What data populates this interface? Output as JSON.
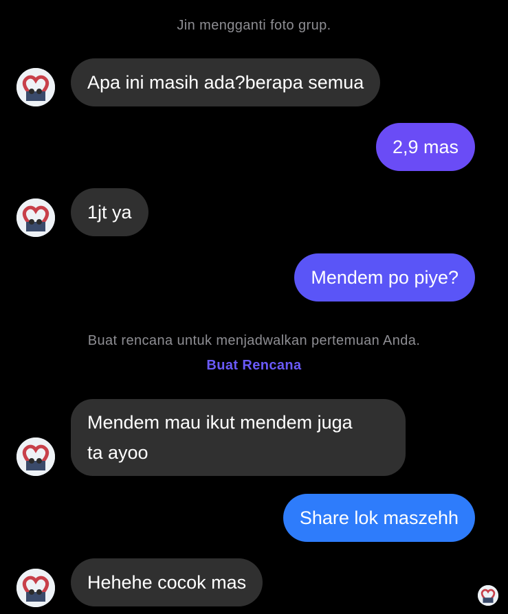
{
  "system": {
    "group_photo_changed": "Jin mengganti foto grup.",
    "plan_prompt": "Buat rencana untuk menjadwalkan pertemuan Anda.",
    "plan_link": "Buat Rencana"
  },
  "messages": [
    {
      "direction": "in",
      "text": "Apa ini masih ada?berapa semua"
    },
    {
      "direction": "out",
      "text": "2,9 mas"
    },
    {
      "direction": "in",
      "text": "1jt ya"
    },
    {
      "direction": "out",
      "text": "Mendem po piye?"
    },
    {
      "direction": "in",
      "line1": "Mendem mau ikut mendem juga",
      "line2": "ta ayoo"
    },
    {
      "direction": "out",
      "text": "Share lok maszehh"
    },
    {
      "direction": "in",
      "text": "Hehehe cocok mas"
    }
  ],
  "colors": {
    "background": "#000000",
    "incoming_bubble": "#303030",
    "outgoing_gradient": [
      "#6a4cf6",
      "#4f5cf8",
      "#3a6bfa",
      "#2e7cfb",
      "#2a84fb"
    ],
    "system_text": "#8e8e93",
    "link": "#6a5af9"
  },
  "icons": {
    "avatar": "contact-avatar-icon",
    "read_receipt": "read-receipt-avatar-icon"
  }
}
